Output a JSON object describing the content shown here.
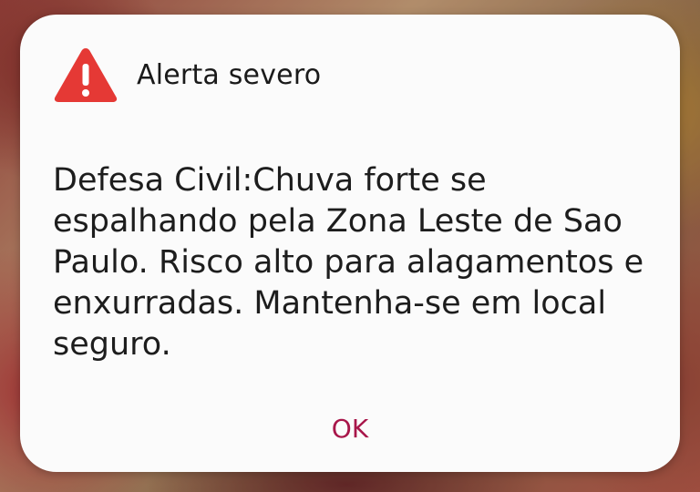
{
  "alert": {
    "icon": "warning-triangle-icon",
    "icon_color": "#e53935",
    "title": "Alerta severo",
    "message": "Defesa Civil:Chuva forte se espalhando pela Zona Leste de Sao Paulo. Risco alto para alagamentos e enxurradas. Mantenha-se em local seguro.",
    "ok_label": "OK",
    "ok_color": "#a8164a"
  }
}
